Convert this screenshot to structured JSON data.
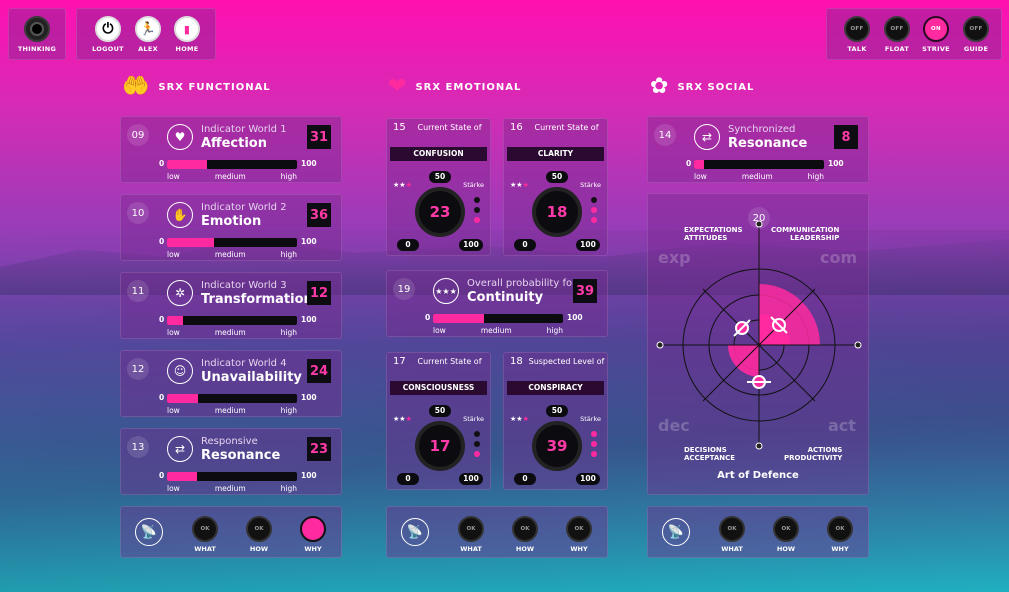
{
  "top_left": [
    {
      "label": "THINKING",
      "icon": "record-icon"
    }
  ],
  "top_nav": [
    {
      "label": "LOGOUT",
      "icon": "power-icon"
    },
    {
      "label": "ALEX",
      "icon": "runner-icon"
    },
    {
      "label": "HOME",
      "icon": "battery-icon"
    }
  ],
  "top_right": [
    {
      "label": "TALK",
      "state": "OFF"
    },
    {
      "label": "FLOAT",
      "state": "OFF"
    },
    {
      "label": "STRIVE",
      "state": "ON"
    },
    {
      "label": "GUIDE",
      "state": "OFF"
    }
  ],
  "colors": {
    "accent": "#ff2aa0",
    "dark": "#0c0c12"
  },
  "functional": {
    "title": "SRX FUNCTIONAL",
    "rows": [
      {
        "num": "09",
        "sub": "Indicator World 1",
        "title": "Affection",
        "value": "31",
        "pct": 0.31,
        "min": "0",
        "max": "100",
        "low": "low",
        "medium": "medium",
        "high": "high",
        "icon": "heart-person-icon"
      },
      {
        "num": "10",
        "sub": "Indicator World 2",
        "title": "Emotion",
        "value": "36",
        "pct": 0.36,
        "min": "0",
        "max": "100",
        "low": "low",
        "medium": "medium",
        "high": "high",
        "icon": "hand-heart-icon"
      },
      {
        "num": "11",
        "sub": "Indicator World 3",
        "title": "Transformation",
        "value": "12",
        "pct": 0.12,
        "min": "0",
        "max": "100",
        "low": "low",
        "medium": "medium",
        "high": "high",
        "icon": "network-icon"
      },
      {
        "num": "12",
        "sub": "Indicator World 4",
        "title": "Unavailability",
        "value": "24",
        "pct": 0.24,
        "min": "0",
        "max": "100",
        "low": "low",
        "medium": "medium",
        "high": "high",
        "icon": "head-icon"
      },
      {
        "num": "13",
        "sub": "Responsive",
        "title": "Resonance",
        "value": "23",
        "pct": 0.23,
        "min": "0",
        "max": "100",
        "low": "low",
        "medium": "medium",
        "high": "high",
        "icon": "hand-arrows-icon"
      }
    ]
  },
  "emotional": {
    "title": "SRX EMOTIONAL",
    "gauges_top": [
      {
        "num": "15",
        "cap": "Current State of",
        "label": "CONFUSION",
        "mid": "50",
        "value": "23",
        "min": "0",
        "max": "100",
        "staerke": "Stärke",
        "dots": [
          false,
          false,
          true
        ]
      },
      {
        "num": "16",
        "cap": "Current State of",
        "label": "CLARITY",
        "mid": "50",
        "value": "18",
        "min": "0",
        "max": "100",
        "staerke": "Stärke",
        "dots": [
          false,
          true,
          true
        ]
      }
    ],
    "continuity": {
      "num": "19",
      "sub": "Overall probability for",
      "title": "Continuity",
      "value": "39",
      "pct": 0.39,
      "min": "0",
      "max": "100",
      "low": "low",
      "medium": "medium",
      "high": "high"
    },
    "gauges_bottom": [
      {
        "num": "17",
        "cap": "Current State of",
        "label": "CONSCIOUSNESS",
        "mid": "50",
        "value": "17",
        "min": "0",
        "max": "100",
        "staerke": "Stärke",
        "dots": [
          false,
          false,
          true
        ]
      },
      {
        "num": "18",
        "cap": "Suspected Level of",
        "label": "CONSPIRACY",
        "mid": "50",
        "value": "39",
        "min": "0",
        "max": "100",
        "staerke": "Stärke",
        "dots": [
          true,
          true,
          true
        ]
      }
    ]
  },
  "social": {
    "title": "SRX SOCIAL",
    "row": {
      "num": "14",
      "sub": "Synchronized",
      "title": "Resonance",
      "value": "8",
      "pct": 0.08,
      "min": "0",
      "max": "100",
      "low": "low",
      "medium": "medium",
      "high": "high"
    },
    "radar": {
      "num": "20",
      "exp1": "EXPECTATIONS",
      "exp2": "ATTITUDES",
      "com1": "COMMUNICATION",
      "com2": "LEADERSHIP",
      "dec1": "DECISIONS",
      "dec2": "ACCEPTANCE",
      "act1": "ACTIONS",
      "act2": "PRODUCTIVITY",
      "big_exp": "exp",
      "big_com": "com",
      "big_dec": "dec",
      "big_act": "act",
      "footer": "Art of Defence"
    }
  },
  "bottom_buttons": {
    "what": "WHAT",
    "how": "HOW",
    "why": "WHY",
    "ok": "OK"
  }
}
